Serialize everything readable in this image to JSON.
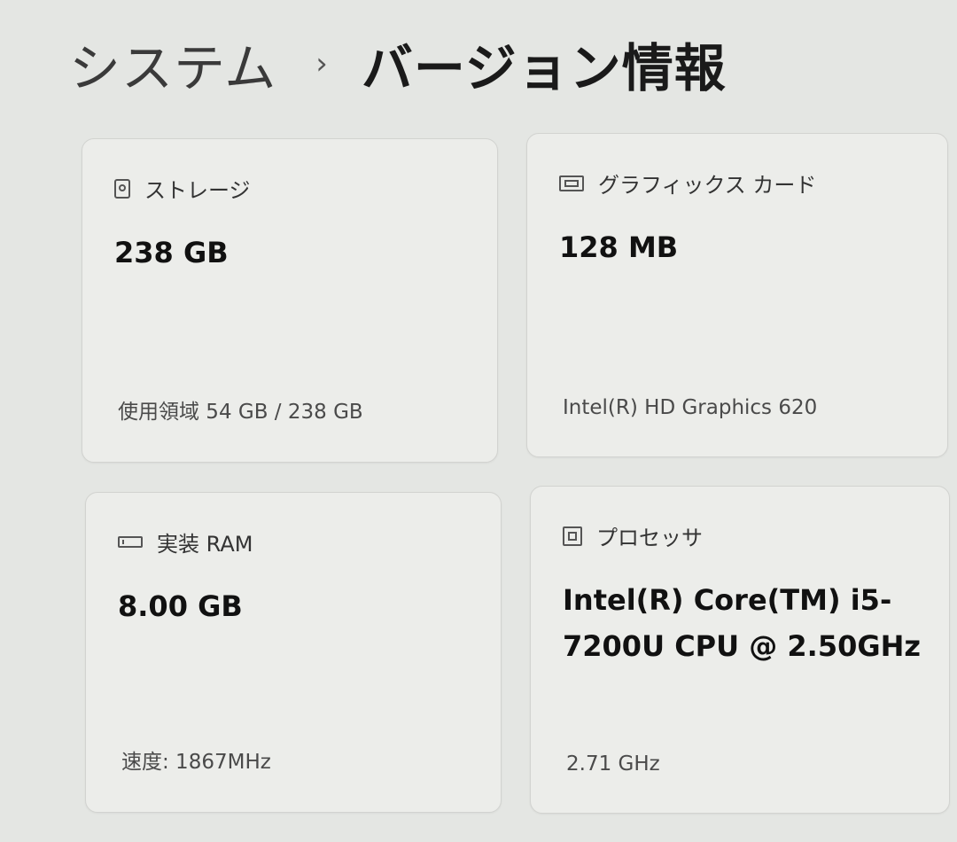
{
  "breadcrumb": {
    "parent": "システム",
    "separator": "›",
    "current": "バージョン情報"
  },
  "cards": {
    "storage": {
      "title": "ストレージ",
      "value": "238 GB",
      "detail": "使用領域 54 GB / 238 GB",
      "icon": "drive-icon"
    },
    "gpu": {
      "title": "グラフィックス カード",
      "value": "128 MB",
      "detail": "Intel(R) HD Graphics 620",
      "icon": "graphics-card-icon"
    },
    "ram": {
      "title": "実装 RAM",
      "value": "8.00 GB",
      "detail": "速度: 1867MHz",
      "icon": "ram-icon"
    },
    "cpu": {
      "title": "プロセッサ",
      "value": "Intel(R) Core(TM) i5-7200U CPU @ 2.50GHz",
      "detail": "2.71 GHz",
      "icon": "processor-icon"
    }
  }
}
